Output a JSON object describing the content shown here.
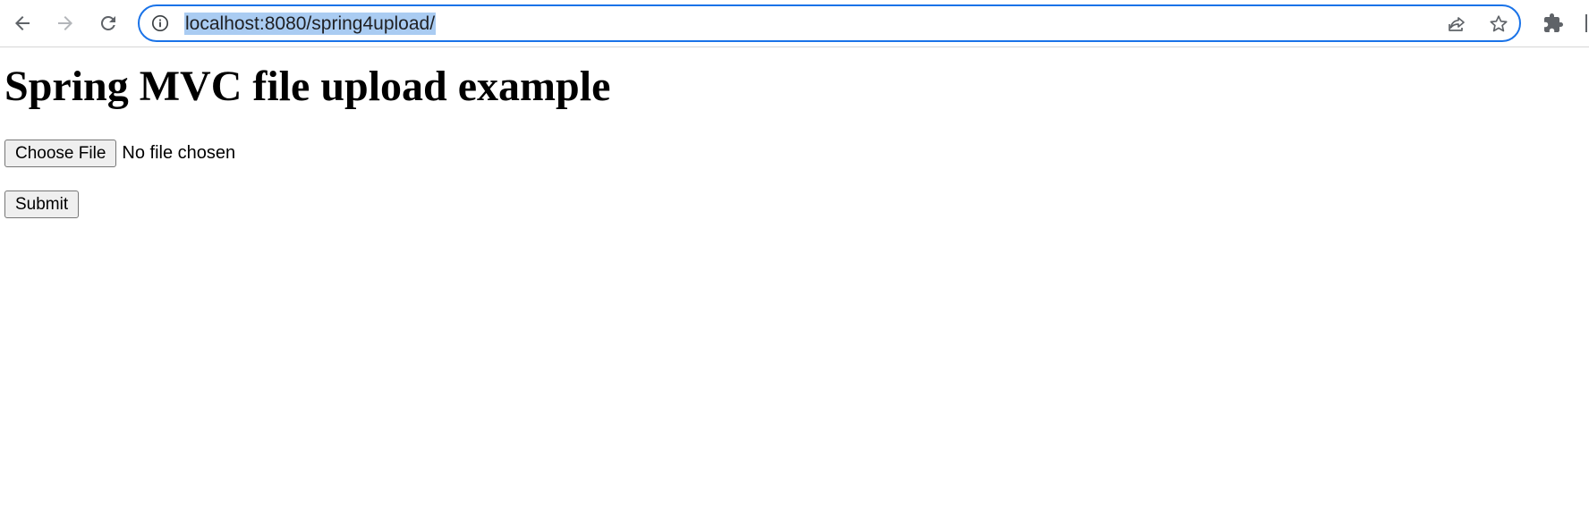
{
  "browser": {
    "url": "localhost:8080/spring4upload/",
    "icons": {
      "back": "back-arrow-icon",
      "forward": "forward-arrow-icon",
      "reload": "reload-icon",
      "site_info": "info-icon",
      "share": "share-icon",
      "bookmark": "star-icon",
      "extensions": "puzzle-piece-icon"
    },
    "colors": {
      "omnibox_focus_border": "#1a73e8",
      "url_selection": "#aaccf2"
    }
  },
  "page": {
    "title": "Spring MVC file upload example",
    "file_input": {
      "button_label": "Choose File",
      "status": "No file chosen"
    },
    "submit_label": "Submit"
  }
}
